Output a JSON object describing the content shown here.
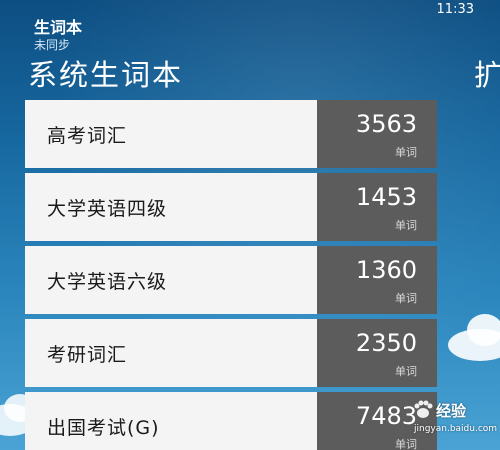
{
  "status_bar": {
    "time": "11:33"
  },
  "header": {
    "app_title": "生词本",
    "sync_status": "未同步",
    "page_title": "系统生词本",
    "next_page_peek": "扩"
  },
  "wordbooks": [
    {
      "name": "高考词汇",
      "count": "3563",
      "unit": "单词"
    },
    {
      "name": "大学英语四级",
      "count": "1453",
      "unit": "单词"
    },
    {
      "name": "大学英语六级",
      "count": "1360",
      "unit": "单词"
    },
    {
      "name": "考研词汇",
      "count": "2350",
      "unit": "单词"
    },
    {
      "name": "出国考试(G)",
      "count": "7483",
      "unit": "单词"
    }
  ],
  "watermark": {
    "brand": "经验",
    "url": "jingyan.baidu.com"
  }
}
